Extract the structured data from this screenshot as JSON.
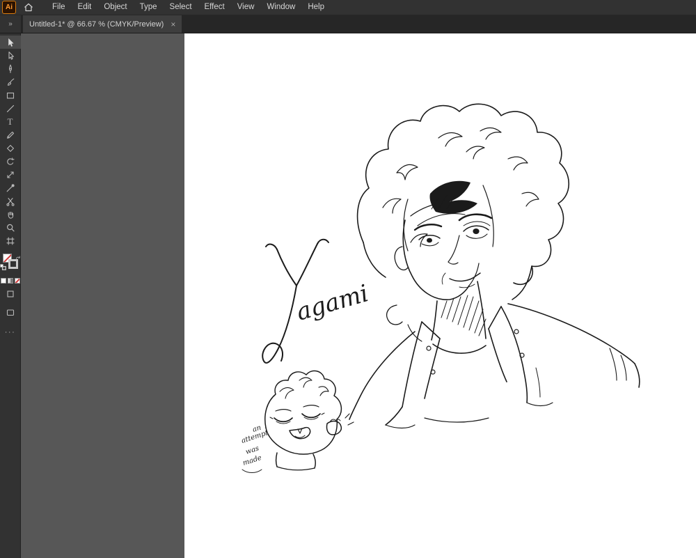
{
  "app": {
    "logo_text": "Ai",
    "menu_items": [
      "File",
      "Edit",
      "Object",
      "Type",
      "Select",
      "Effect",
      "View",
      "Window",
      "Help"
    ]
  },
  "tab": {
    "title": "Untitled-1* @ 66.67 % (CMYK/Preview)",
    "close_glyph": "×"
  },
  "toolbar": {
    "expand_chevron": "»",
    "type_tool_glyph": "T",
    "more_glyph": "···",
    "tools": [
      "selection-tool",
      "direct-selection-tool",
      "pen-tool",
      "paintbrush-tool",
      "rectangle-tool",
      "line-segment-tool",
      "type-tool",
      "pencil-tool",
      "shaper-tool",
      "rotate-tool",
      "scale-tool",
      "eyedropper-tool",
      "scissors-tool",
      "hand-tool",
      "zoom-tool",
      "artboard-tool"
    ],
    "swatch_controls": [
      "fill-none-swatch",
      "stroke-swatch",
      "swap-fill-stroke",
      "default-fill-stroke",
      "color-mode",
      "gradient-mode",
      "none-mode",
      "draw-mode",
      "screen-mode",
      "edit-toolbar"
    ]
  },
  "canvas": {
    "zoom_percent": "66.67",
    "color_mode": "CMYK",
    "view_mode": "Preview"
  },
  "artwork": {
    "signature": "Yagami",
    "signature_tail": "agami",
    "caption_lines": [
      "an",
      "attempt",
      "was",
      "made"
    ]
  },
  "colors": {
    "chrome": "#323232",
    "tab_active": "#3e3e3e",
    "pasteboard": "#575757",
    "artboard": "#ffffff",
    "ink": "#1b1b1b",
    "logo_orange": "#ff9c33",
    "none_slash_red": "#d23b3b"
  }
}
